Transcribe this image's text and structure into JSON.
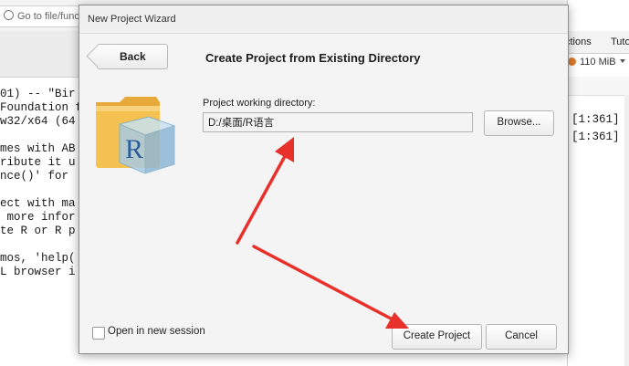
{
  "background": {
    "goto_placeholder": "Go to file/funct",
    "console_lines": [
      "01) -- \"Bir",
      "Foundation f",
      "w32/x64 (64",
      "",
      "mes with AB",
      "ribute it u",
      "nce()' for",
      "",
      "ect with ma",
      " more infor",
      "te R or R p",
      "",
      "mos, 'help(",
      "L browser i"
    ],
    "right_tabs": [
      "ctions",
      "Tuto"
    ],
    "memory": "110 MiB",
    "index_rows": [
      "[1:361]",
      "[1:361]"
    ]
  },
  "dialog": {
    "window_title": "New Project Wizard",
    "back_label": "Back",
    "heading": "Create Project from Existing Directory",
    "dir_label": "Project working directory:",
    "dir_value": "D:/桌面/R语言",
    "browse_label": "Browse...",
    "new_session_label": "Open in new session",
    "new_session_checked": false,
    "create_label": "Create Project",
    "cancel_label": "Cancel"
  },
  "annotations": {
    "arrow_color": "#e8312a"
  },
  "colors": {
    "folder": "#f5c150",
    "r_cube": "#8fb7d6"
  }
}
